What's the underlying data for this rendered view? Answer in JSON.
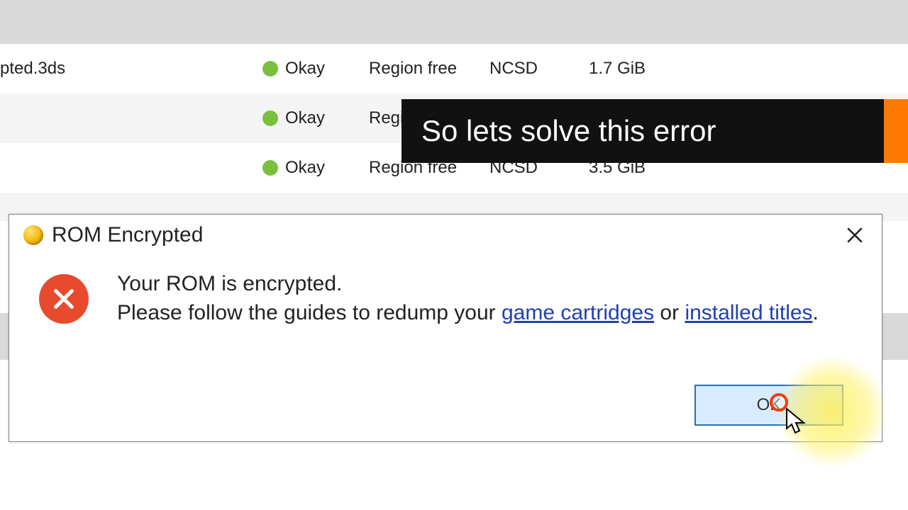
{
  "rows": [
    {
      "filename": "pted.3ds",
      "status": "Okay",
      "region": "Region free",
      "format": "NCSD",
      "size": "1.7 GiB"
    },
    {
      "filename": "",
      "status": "Okay",
      "region": "Regio",
      "format": "",
      "size": ""
    },
    {
      "filename": "",
      "status": "Okay",
      "region": "Region free",
      "format": "NCSD",
      "size": "3.5 GiB"
    }
  ],
  "caption": {
    "text": "So lets solve this error"
  },
  "dialog": {
    "title": "ROM Encrypted",
    "line1": "Your ROM is encrypted.",
    "line2_a": "Please follow the guides to redump your ",
    "link1": "game cartridges",
    "line2_b": " or ",
    "link2": "installed titles",
    "line2_c": ".",
    "ok_label": "OK"
  }
}
